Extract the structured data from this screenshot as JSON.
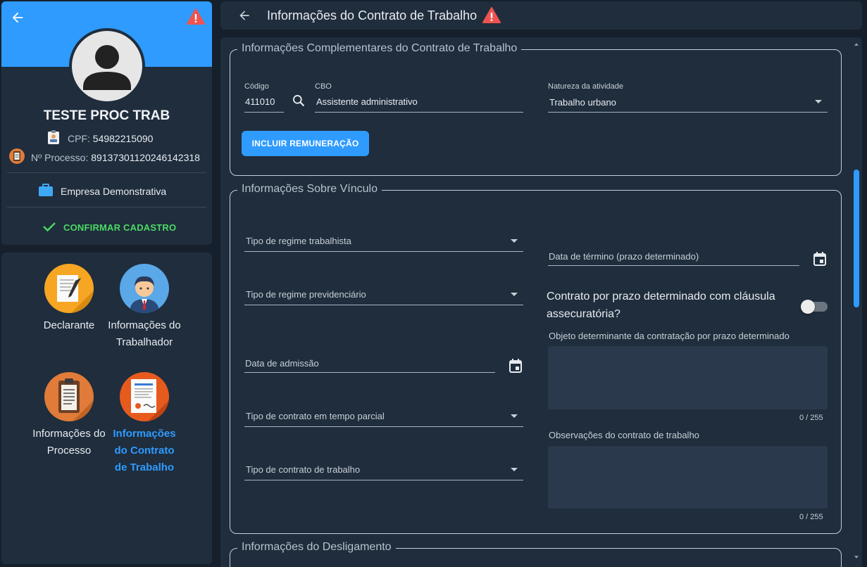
{
  "profile": {
    "name": "TESTE PROC TRAB",
    "cpf_label": "CPF:",
    "cpf_value": "54982215090",
    "processo_label": "Nº Processo:",
    "processo_value": "89137301120246142318",
    "empresa": "Empresa Demonstrativa",
    "confirm_label": "CONFIRMAR CADASTRO"
  },
  "nav": {
    "declarante": "Declarante",
    "trabalhador": "Informações do Trabalhador",
    "processo": "Informações do Processo",
    "contrato": "Informações do Contrato de Trabalho"
  },
  "header": {
    "title": "Informações do Contrato de Trabalho"
  },
  "complementares": {
    "legend": "Informações Complementares do Contrato de Trabalho",
    "codigo_label": "Código",
    "codigo_value": "411010",
    "cbo_label": "CBO",
    "cbo_value": "Assistente administrativo",
    "natureza_label": "Natureza da atividade",
    "natureza_value": "Trabalho urbano",
    "incluir_button": "INCLUIR REMUNERAÇÃO"
  },
  "vinculo": {
    "legend": "Informações Sobre Vínculo",
    "regime_trabalhista": "Tipo de regime trabalhista",
    "regime_previdenciario": "Tipo de regime previdenciário",
    "data_admissao": "Data de admissão",
    "tempo_parcial": "Tipo de contrato em tempo parcial",
    "tipo_contrato": "Tipo de contrato de trabalho",
    "data_termino": "Data de término (prazo determinado)",
    "clausula_question": "Contrato por prazo determinado com cláusula assecuratória?",
    "objeto_label": "Objeto determinante da contratação por prazo determinado",
    "objeto_counter": "0 / 255",
    "observacoes_label": "Observações do contrato de trabalho",
    "observacoes_counter": "0 / 255"
  },
  "desligamento": {
    "legend": "Informações do Desligamento"
  },
  "colors": {
    "accent": "#2f9bff",
    "panel": "#1f2d3d",
    "background": "#15202c",
    "success": "#4cd964",
    "warning": "#ef5350"
  }
}
